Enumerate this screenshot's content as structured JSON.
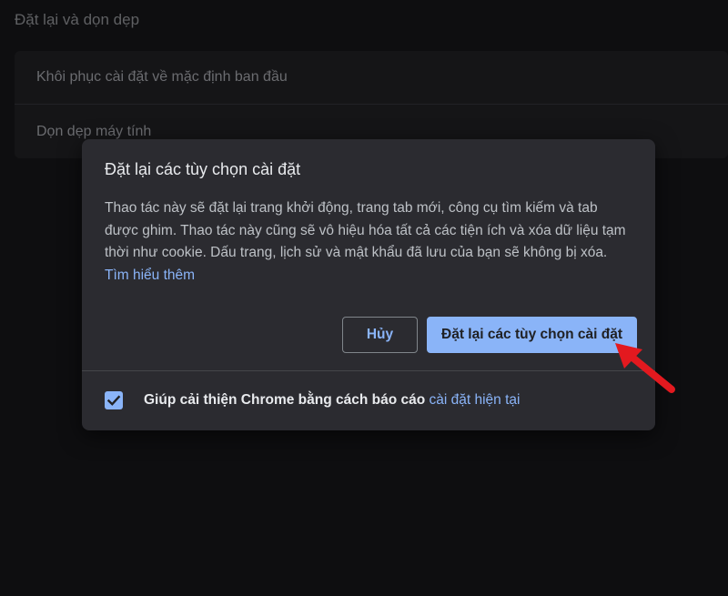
{
  "section": {
    "title": "Đặt lại và dọn dẹp"
  },
  "settings": {
    "items": [
      {
        "label": "Khôi phục cài đặt về mặc định ban đầu"
      },
      {
        "label": "Dọn dẹp máy tính"
      }
    ]
  },
  "dialog": {
    "title": "Đặt lại các tùy chọn cài đặt",
    "body": "Thao tác này sẽ đặt lại trang khởi động, trang tab mới, công cụ tìm kiếm và tab được ghim. Thao tác này cũng sẽ vô hiệu hóa tất cả các tiện ích và xóa dữ liệu tạm thời như cookie. Dấu trang, lịch sử và mật khẩu đã lưu của bạn sẽ không bị xóa.",
    "learn_more": "Tìm hiểu thêm",
    "cancel_label": "Hủy",
    "reset_label": "Đặt lại các tùy chọn cài đặt",
    "report_text": "Giúp cải thiện Chrome bằng cách báo cáo",
    "report_link": "cài đặt hiện tại",
    "report_checked": true
  },
  "colors": {
    "accent": "#8ab4f8",
    "dialog_bg": "#2b2b30",
    "page_bg": "#0e0e10",
    "annotation_arrow": "#e3191f"
  },
  "icons": {
    "checkbox": "checkmark-icon",
    "annotation": "red-arrow-icon"
  }
}
